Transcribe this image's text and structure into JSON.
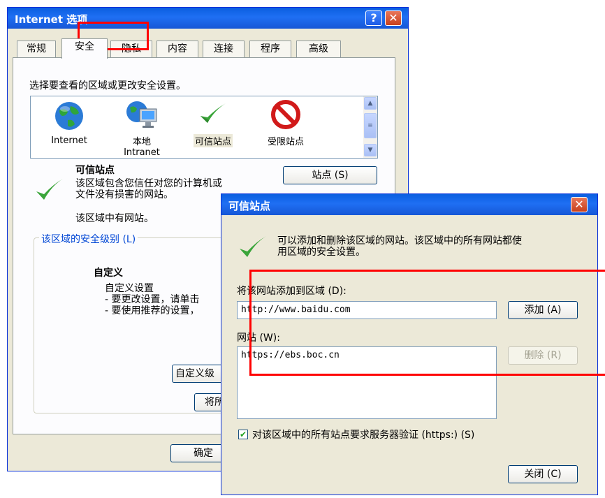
{
  "internet_options": {
    "title": "Internet 选项",
    "tabs": [
      "常规",
      "安全",
      "隐私",
      "内容",
      "连接",
      "程序",
      "高级"
    ],
    "zone_prompt": "选择要查看的区域或更改安全设置。",
    "zones": [
      {
        "label": "Internet",
        "sub": ""
      },
      {
        "label": "本地",
        "sub": "Intranet"
      },
      {
        "label": "可信站点",
        "sub": ""
      },
      {
        "label": "受限站点",
        "sub": ""
      }
    ],
    "zone_title": "可信站点",
    "zone_desc_1": "该区域包含您信任对您的计算机或",
    "zone_desc_2": "文件没有损害的网站。",
    "zone_has_sites": "该区域中有网站。",
    "sites_button": "站点 (S)",
    "security_level_label": "该区域的安全级别 (L)",
    "custom_title": "自定义",
    "custom_line_1": "自定义设置",
    "custom_line_2": "- 要更改设置，请单击",
    "custom_line_3": "- 要使用推荐的设置，",
    "custom_level_button": "自定义级",
    "default_level_button": "将所",
    "ok_button": "确定"
  },
  "trusted_sites": {
    "title": "可信站点",
    "desc_1": "可以添加和删除该区域的网站。该区域中的所有网站都使",
    "desc_2": "用区域的安全设置。",
    "add_label": "将该网站添加到区域 (D):",
    "add_value": "http://www.baidu.com",
    "add_button": "添加 (A)",
    "sites_label": "网站 (W):",
    "sites": [
      "https://ebs.boc.cn"
    ],
    "remove_button": "删除 (R)",
    "https_check_label": "对该区域中的所有站点要求服务器验证 (https:) (S)",
    "https_checked": true,
    "close_button": "关闭 (C)"
  }
}
